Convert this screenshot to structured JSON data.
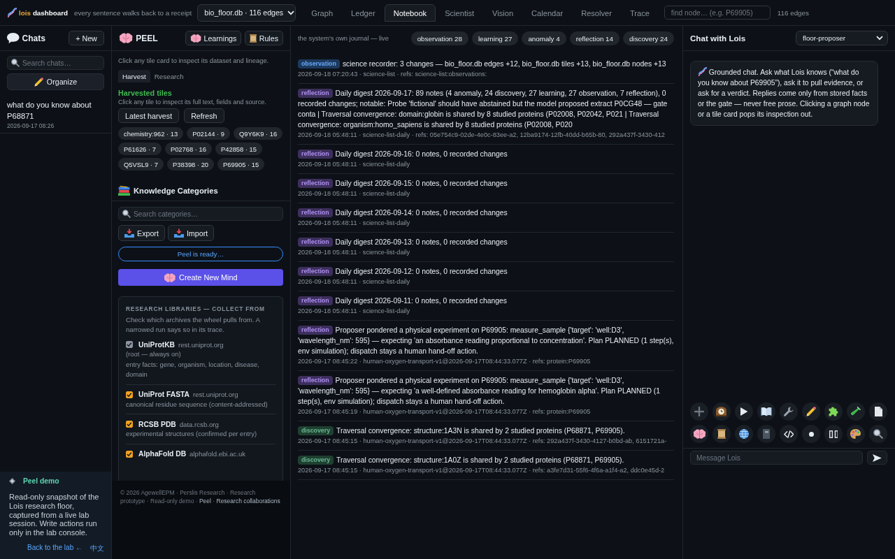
{
  "top_bar": {
    "brand": "lois",
    "product": "dashboard",
    "tagline": "every sentence walks back to a receipt",
    "database_select": "bio_floor.db · 116 edges",
    "tabs": [
      {
        "label": "Graph",
        "selected": false
      },
      {
        "label": "Ledger",
        "selected": false
      },
      {
        "label": "Notebook",
        "selected": true
      },
      {
        "label": "Scientist",
        "selected": false
      },
      {
        "label": "Vision",
        "selected": false
      },
      {
        "label": "Calendar",
        "selected": false
      },
      {
        "label": "Resolver",
        "selected": false
      },
      {
        "label": "Trace",
        "selected": false
      }
    ],
    "search": {
      "placeholder": "find node… (e.g. P69905)"
    },
    "edge_count": "116 edges"
  },
  "chats": {
    "title": "Chats",
    "new_button": "+ New",
    "search": {
      "placeholder": "Search chats…"
    },
    "organize_button": "Organize",
    "items": [
      {
        "title": "what do you know about P68871",
        "time": "2026-09-17 08:26"
      }
    ]
  },
  "demo_notice": {
    "title": "Peel demo",
    "text": "Read-only snapshot of the Lois research floor, captured from a live lab session. Write actions run only in the lab console.",
    "links": [
      "Back to the lab ←",
      "中文"
    ]
  },
  "peel": {
    "title": "PEEL",
    "buttons": [
      "Learnings",
      "Rules"
    ],
    "hint": "Click any tile card to inspect its dataset and lineage.",
    "tabs": [
      {
        "label": "Harvest",
        "selected": true
      },
      {
        "label": "Research",
        "selected": false
      }
    ],
    "harvest": {
      "title": "Harvested tiles",
      "hint": "Click any tile to inspect its full text, fields and source.",
      "buttons": [
        "Latest harvest",
        "Refresh"
      ],
      "tiles": [
        "chemistry:962 · 13",
        "P02144 · 9",
        "Q9Y6K9 · 16",
        "P61626 · 7",
        "P02768 · 16",
        "P42858 · 15",
        "Q5VSL9 · 7",
        "P38398 · 20",
        "P69905 · 15"
      ]
    },
    "knowledge": {
      "title": "Knowledge Categories",
      "search": {
        "placeholder": "Search categories…"
      },
      "buttons": [
        "Export",
        "Import"
      ],
      "status": "Peel is ready…",
      "create_button": "Create New Mind",
      "libraries": {
        "title": "RESEARCH LIBRARIES — COLLECT FROM",
        "text": "Check which archives the wheel pulls from. A narrowed run says so in its trace.",
        "items": [
          {
            "name": "UniProtKB",
            "host": "rest.uniprot.org",
            "note": "(root — always on)",
            "description": "entry facts: gene, organism, location, disease, domain",
            "checked": true,
            "disabled": true
          },
          {
            "name": "UniProt FASTA",
            "host": "rest.uniprot.org",
            "description": "canonical residue sequence (content-addressed)",
            "checked": true,
            "disabled": false
          },
          {
            "name": "RCSB PDB",
            "host": "data.rcsb.org",
            "description": "experimental structures (confirmed per entry)",
            "checked": true,
            "disabled": false
          },
          {
            "name": "AlphaFold DB",
            "host": "alphafold.ebi.ac.uk",
            "checked": true,
            "disabled": false
          }
        ]
      }
    },
    "footer": [
      {
        "kind": "plain",
        "text": "© 2026 AgewellEPM · Perslis Research · Research prototype · Read-only demo ·"
      },
      {
        "kind": "link",
        "text": "Peel"
      },
      {
        "kind": "plain",
        "text": "·"
      },
      {
        "kind": "link",
        "text": "Research collaborations"
      }
    ]
  },
  "notebook": {
    "subtitle": "the system's own journal — live",
    "counts": [
      "observation 28",
      "learning 27",
      "anomaly 4",
      "reflection 14",
      "discovery 24"
    ],
    "entries": [
      {
        "tag": "observation",
        "color": "#1d3a5e",
        "text": "science recorder: 3 changes — bio_floor.db edges +12, bio_floor.db tiles +13, bio_floor.db nodes +13",
        "meta": "2026-09-18 07:20:43 · science-list · refs: science-list:observations:"
      },
      {
        "tag": "reflection",
        "color": "#3d2f5c",
        "text": "Daily digest 2026-09-17: 89 notes (4 anomaly, 24 discovery, 27 learning, 27 observation, 7 reflection), 0 recorded changes; notable: Probe 'fictional' should have abstained but the model proposed extract P0CG48 — gate conta | Traversal convergence: domain:globin is shared by 8 studied proteins (P02008, P02042, P021 | Traversal convergence: organism:homo_sapiens is shared by 8 studied proteins (P02008, P020",
        "meta": "2026-09-18 05:48:11 · science-list-daily · refs: 05e754c9-02de-4e0c-83ee-a2, 12ba9174-12fb-40dd-b65b-80, 292a437f-3430-412"
      },
      {
        "tag": "reflection",
        "color": "#3d2f5c",
        "text": "Daily digest 2026-09-16: 0 notes, 0 recorded changes",
        "meta": "2026-09-18 05:48:11 · science-list-daily"
      },
      {
        "tag": "reflection",
        "color": "#3d2f5c",
        "text": "Daily digest 2026-09-15: 0 notes, 0 recorded changes",
        "meta": "2026-09-18 05:48:11 · science-list-daily"
      },
      {
        "tag": "reflection",
        "color": "#3d2f5c",
        "text": "Daily digest 2026-09-14: 0 notes, 0 recorded changes",
        "meta": "2026-09-18 05:48:11 · science-list-daily"
      },
      {
        "tag": "reflection",
        "color": "#3d2f5c",
        "text": "Daily digest 2026-09-13: 0 notes, 0 recorded changes",
        "meta": "2026-09-18 05:48:11 · science-list-daily"
      },
      {
        "tag": "reflection",
        "color": "#3d2f5c",
        "text": "Daily digest 2026-09-12: 0 notes, 0 recorded changes",
        "meta": "2026-09-18 05:48:11 · science-list-daily"
      },
      {
        "tag": "reflection",
        "color": "#3d2f5c",
        "text": "Daily digest 2026-09-11: 0 notes, 0 recorded changes",
        "meta": "2026-09-18 05:48:11 · science-list-daily"
      },
      {
        "tag": "reflection",
        "color": "#3d2f5c",
        "text": "Proposer pondered a physical experiment on P69905: measure_sample {'target': 'well:D3', 'wavelength_nm': 595} — expecting 'an absorbance reading proportional to concentration'. Plan PLANNED (1 step(s), env simulation); dispatch stays a human hand-off action.",
        "meta": "2026-09-17 08:45:22 · human-oxygen-transport-v1@2026-09-17T08:44:33.077Z · refs: protein:P69905"
      },
      {
        "tag": "reflection",
        "color": "#3d2f5c",
        "text": "Proposer pondered a physical experiment on P69905: measure_sample {'target': 'well:D3', 'wavelength_nm': 595} — expecting 'a well-defined absorbance reading for hemoglobin alpha'. Plan PLANNED (1 step(s), env simulation); dispatch stays a human hand-off action.",
        "meta": "2026-09-17 08:45:19 · human-oxygen-transport-v1@2026-09-17T08:44:33.077Z · refs: protein:P69905"
      },
      {
        "tag": "discovery",
        "color": "#1e4030",
        "text": "Traversal convergence: structure:1A3N is shared by 2 studied proteins (P68871, P69905).",
        "meta": "2026-09-17 08:45:15 · human-oxygen-transport-v1@2026-09-17T08:44:33.077Z · refs: 292a437f-3430-4127-b0bd-ab, 6151721a-"
      },
      {
        "tag": "discovery",
        "color": "#1e4030",
        "text": "Traversal convergence: structure:1A0Z is shared by 2 studied proteins (P68871, P69905).",
        "meta": "2026-09-17 08:45:15 · human-oxygen-transport-v1@2026-09-17T08:44:33.077Z · refs: a3fe7d31-55f6-4f6a-a1f4-a2, ddc0e45d-2"
      }
    ]
  },
  "chat": {
    "title": "Chat with Lois",
    "model_select": "floor-proposer",
    "intro": "Grounded chat. Ask what Lois knows (“what do you know about P69905”), ask it to pull evidence, or ask for a verdict. Replies come only from stored facts or the gate — never free prose. Clicking a graph node or a tile card pops its inspection out.",
    "message": {
      "placeholder": "Message Lois"
    }
  }
}
